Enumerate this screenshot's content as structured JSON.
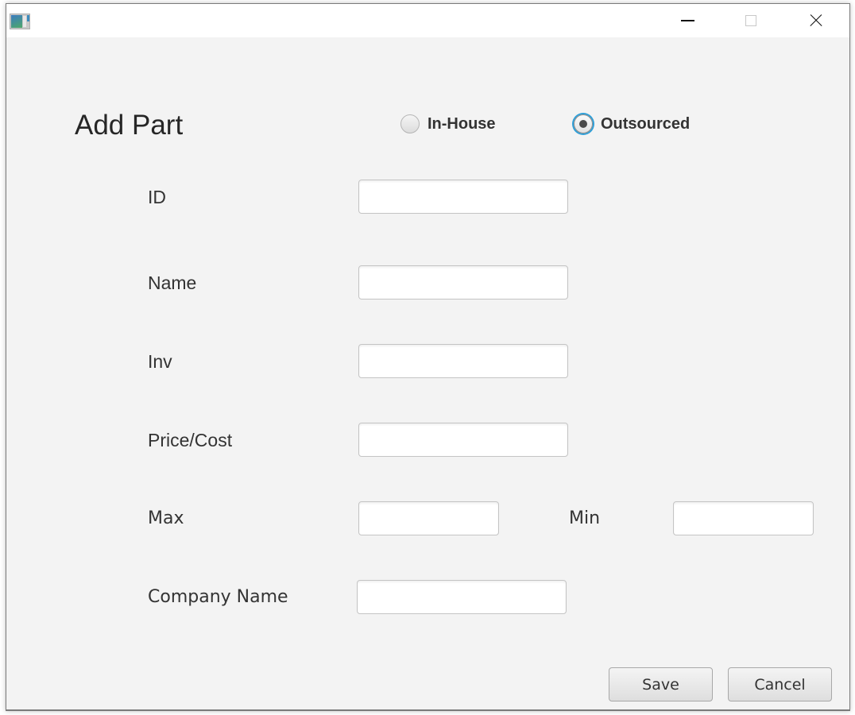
{
  "window": {
    "title": "",
    "controls": {
      "minimize": "minimize",
      "maximize": "maximize",
      "close": "close"
    }
  },
  "form": {
    "title": "Add Part",
    "source_options": [
      {
        "label": "In-House",
        "selected": false
      },
      {
        "label": "Outsourced",
        "selected": true
      }
    ],
    "fields": {
      "id": {
        "label": "ID",
        "value": "",
        "placeholder": ""
      },
      "name": {
        "label": "Name",
        "value": "",
        "placeholder": ""
      },
      "inv": {
        "label": "Inv",
        "value": "",
        "placeholder": ""
      },
      "price": {
        "label": "Price/Cost",
        "value": "",
        "placeholder": ""
      },
      "max": {
        "label": "Max",
        "value": "",
        "placeholder": ""
      },
      "min": {
        "label": "Min",
        "value": "",
        "placeholder": ""
      },
      "company": {
        "label": "Company Name",
        "value": "",
        "placeholder": ""
      }
    },
    "buttons": {
      "save": "Save",
      "cancel": "Cancel"
    }
  },
  "colors": {
    "focus_ring": "#2e9fd8",
    "background": "#f3f3f3"
  }
}
